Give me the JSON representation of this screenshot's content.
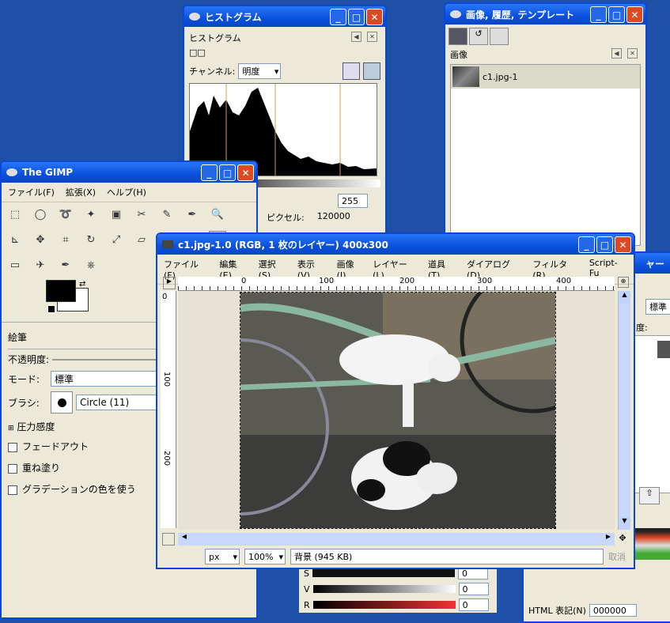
{
  "hist": {
    "title": "ヒストグラム",
    "heading": "ヒストグラム",
    "squares": "□□",
    "channel_label": "チャンネル:",
    "channel_value": "明度",
    "pixel_label": "ピクセル:",
    "pixel_value": "120000",
    "end_value": "255"
  },
  "imgwin": {
    "title": "画像, 履歴, テンプレート",
    "panel_label": "画像",
    "item": "c1.jpg-1"
  },
  "gimp": {
    "title": "The GIMP",
    "menu": [
      "ファイル(F)",
      "拡張(X)",
      "ヘルプ(H)"
    ],
    "tool_icons": [
      "rect-select-icon",
      "ellipse-select-icon",
      "lasso-icon",
      "fuzzy-select-icon",
      "color-select-icon",
      "scissors-icon",
      "paths-icon",
      "color-picker-icon",
      "zoom-icon",
      "measure-icon",
      "move-icon",
      "crop-icon",
      "rotate-icon",
      "scale-icon",
      "shear-icon",
      "perspective-icon",
      "pencil-icon",
      "paintbrush-icon",
      "eraser-icon",
      "airbrush-icon",
      "ink-icon",
      "clone-icon"
    ],
    "opts_title": "絵筆",
    "opacity": "不透明度:",
    "mode_label": "モード:",
    "mode_value": "標準",
    "brush_label": "ブラシ:",
    "brush_value": "Circle (11)",
    "pressure": "圧力感度",
    "fade": "フェードアウト",
    "incr": "重ね塗り",
    "grad": "グラデーションの色を使う"
  },
  "canvas": {
    "title": "c1.jpg-1.0 (RGB, 1 枚のレイヤー) 400x300",
    "menu": [
      "ファイル(F)",
      "編集(E)",
      "選択(S)",
      "表示(V)",
      "画像(I)",
      "レイヤー(L)",
      "道具(T)",
      "ダイアログ(D)",
      "フィルタ(R)",
      "Script-Fu"
    ],
    "ruler_h": [
      "0",
      "100",
      "200",
      "300",
      "400"
    ],
    "ruler_v": [
      "0",
      "100",
      "200"
    ],
    "unit": "px",
    "zoom": "100%",
    "status": "背景 (945 KB)",
    "cancel": "取消"
  },
  "layers": {
    "title_fragment": "ャー",
    "mode_fragment": "標準",
    "opacity_fragment": "度:"
  },
  "colors": {
    "s_label": "S",
    "v_label": "V",
    "r_label": "R",
    "s_value": "0",
    "v_value": "0",
    "r_value": "0"
  },
  "html_notation": {
    "label": "HTML 表記(N)",
    "value": "000000"
  }
}
